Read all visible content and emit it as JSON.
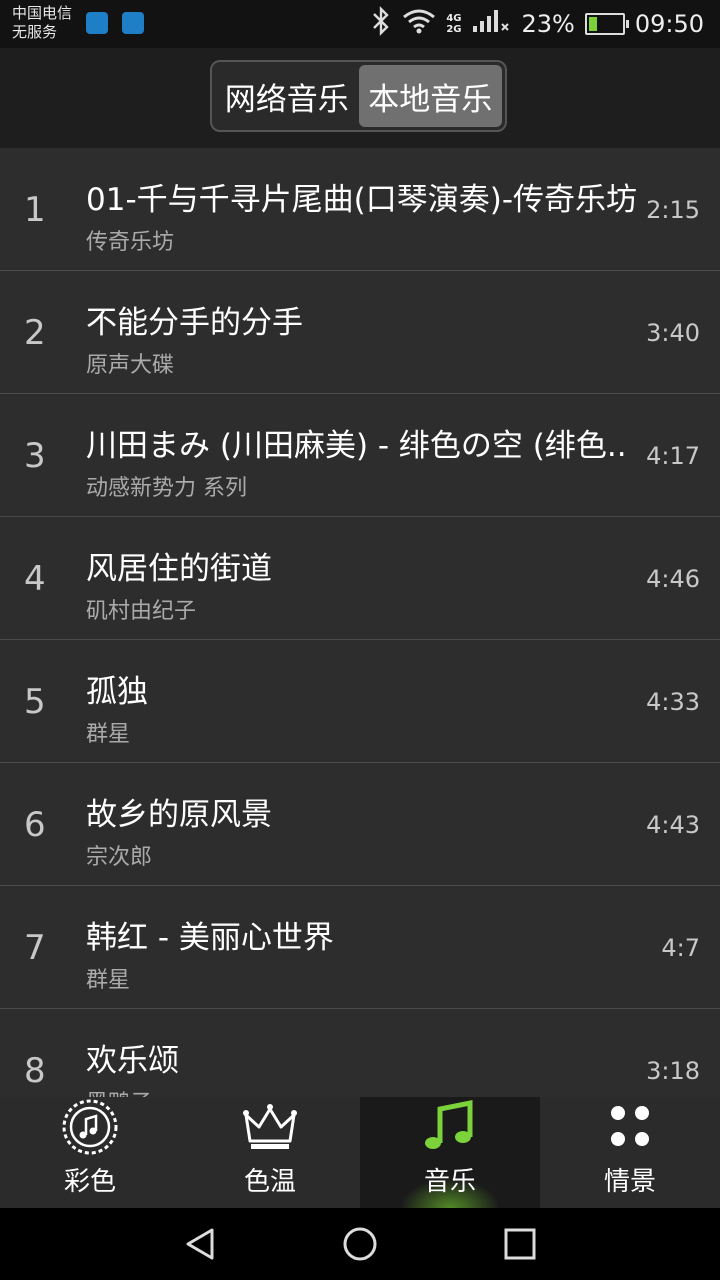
{
  "status_bar": {
    "carrier_line1": "中国电信",
    "carrier_line2": "无服务",
    "network_4g": "4G",
    "network_2g": "2G",
    "battery": "23%",
    "time": "09:50"
  },
  "segment": {
    "online_label": "网络音乐",
    "local_label": "本地音乐",
    "active": "local"
  },
  "songs": [
    {
      "index": "1",
      "title": "01-千与千寻片尾曲(口琴演奏)-传奇乐坊",
      "artist": "传奇乐坊",
      "duration": "2:15"
    },
    {
      "index": "2",
      "title": "不能分手的分手",
      "artist": "原声大碟",
      "duration": "3:40"
    },
    {
      "index": "3",
      "title": "川田まみ (川田麻美) - 绯色の空 (绯色..",
      "artist": "动感新势力 系列",
      "duration": "4:17"
    },
    {
      "index": "4",
      "title": "风居住的街道",
      "artist": "矶村由纪子",
      "duration": "4:46"
    },
    {
      "index": "5",
      "title": "孤独",
      "artist": "群星",
      "duration": "4:33"
    },
    {
      "index": "6",
      "title": "故乡的原风景",
      "artist": "宗次郎",
      "duration": "4:43"
    },
    {
      "index": "7",
      "title": "韩红 - 美丽心世界",
      "artist": "群星",
      "duration": "4:7"
    },
    {
      "index": "8",
      "title": "欢乐颂",
      "artist": "黑鸭子",
      "duration": "3:18"
    }
  ],
  "tabs": [
    {
      "label": "彩色",
      "icon": "music-face-icon"
    },
    {
      "label": "色温",
      "icon": "crown-icon"
    },
    {
      "label": "音乐",
      "icon": "music-note-icon",
      "active": true
    },
    {
      "label": "情景",
      "icon": "four-dots-icon"
    }
  ],
  "colors": {
    "accent_green": "#7bd23a",
    "background": "#2d2d2d",
    "header": "#1e1e1e"
  }
}
